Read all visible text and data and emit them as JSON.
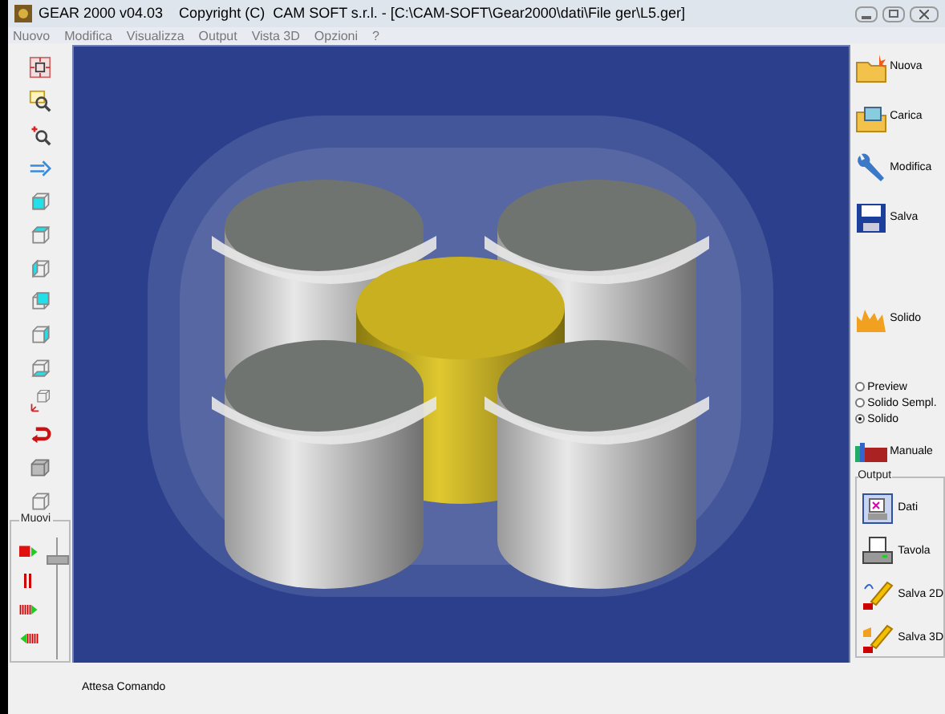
{
  "window": {
    "title": "GEAR 2000 v04.03    Copyright (C)  CAM SOFT s.r.l. - [C:\\CAM-SOFT\\Gear2000\\dati\\File ger\\L5.ger]"
  },
  "menu": [
    "Nuovo",
    "Modifica",
    "Visualizza",
    "Output",
    "Vista 3D",
    "Opzioni",
    "?"
  ],
  "left_toolbar": {
    "move_group": {
      "title": "Muovi",
      "slider": {
        "level": 0.85
      }
    }
  },
  "right_panel": {
    "buttons": [
      "Nuova",
      "Carica",
      "Modifica",
      "Salva",
      "Solido"
    ],
    "render_modes": [
      {
        "label": "Preview",
        "selected": false
      },
      {
        "label": "Solido Sempl.",
        "selected": false
      },
      {
        "label": "Solido",
        "selected": true
      }
    ],
    "manual_button": "Manuale",
    "output": {
      "title": "Output",
      "buttons": [
        "Dati",
        "Tavola",
        "Salva 2D",
        "Salva 3D"
      ]
    }
  },
  "status_bar": {
    "text": "Attesa Comando"
  }
}
